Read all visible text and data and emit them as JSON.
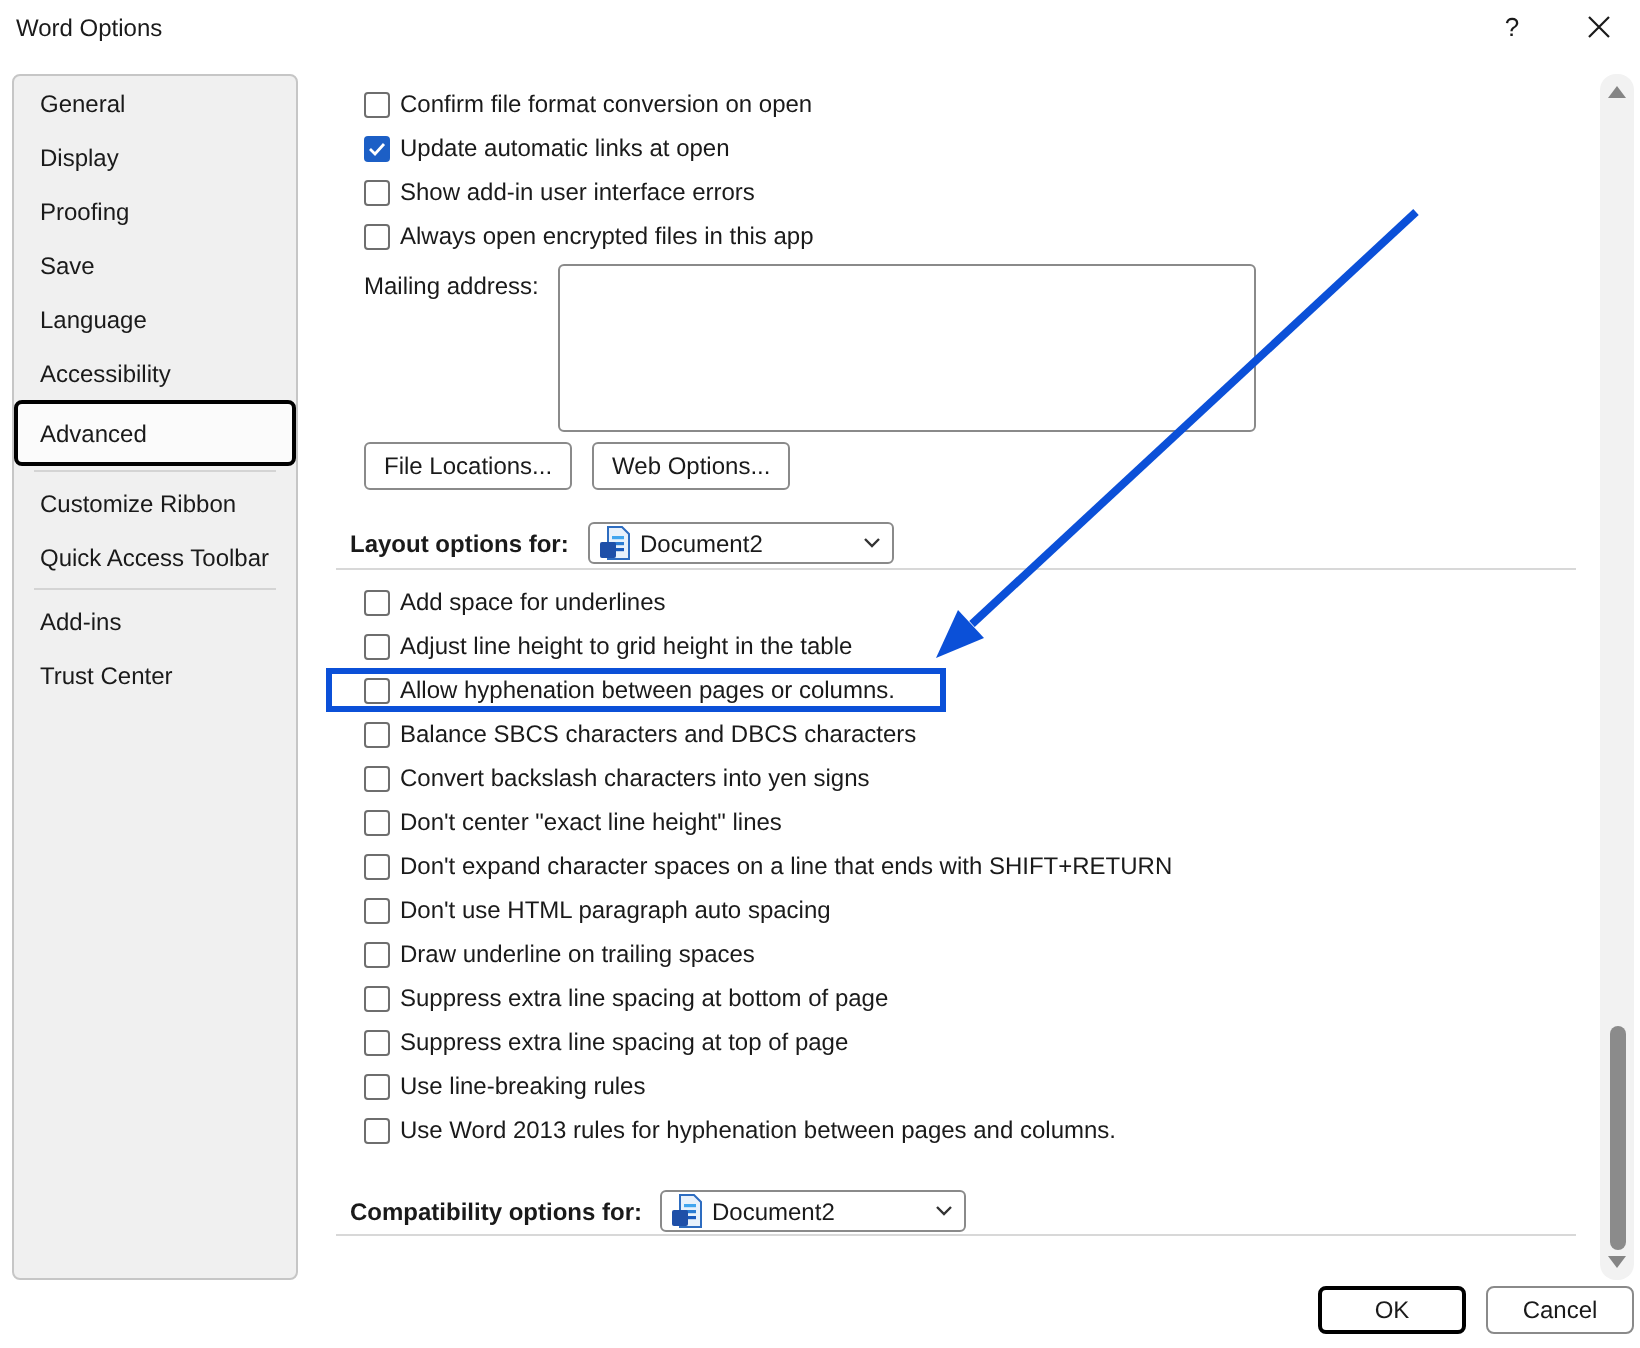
{
  "window": {
    "title": "Word Options",
    "help_label": "?"
  },
  "sidebar": {
    "groups": [
      {
        "items": [
          {
            "label": "General",
            "selected": false
          },
          {
            "label": "Display",
            "selected": false
          },
          {
            "label": "Proofing",
            "selected": false
          },
          {
            "label": "Save",
            "selected": false
          },
          {
            "label": "Language",
            "selected": false
          },
          {
            "label": "Accessibility",
            "selected": false
          },
          {
            "label": "Advanced",
            "selected": true
          }
        ]
      },
      {
        "items": [
          {
            "label": "Customize Ribbon",
            "selected": false
          },
          {
            "label": "Quick Access Toolbar",
            "selected": false
          }
        ]
      },
      {
        "items": [
          {
            "label": "Add-ins",
            "selected": false
          },
          {
            "label": "Trust Center",
            "selected": false
          }
        ]
      }
    ]
  },
  "general_options": [
    {
      "label": "Confirm file format conversion on open",
      "checked": false
    },
    {
      "label": "Update automatic links at open",
      "checked": true
    },
    {
      "label": "Show add-in user interface errors",
      "checked": false
    },
    {
      "label": "Always open encrypted files in this app",
      "checked": false
    }
  ],
  "mailing_address": {
    "label": "Mailing address:"
  },
  "buttons": [
    {
      "label": "File Locations..."
    },
    {
      "label": "Web Options..."
    }
  ],
  "layout_section": {
    "label": "Layout options for:",
    "document": "Document2",
    "options": [
      {
        "label": "Add space for underlines",
        "checked": false,
        "highlighted": false
      },
      {
        "label": "Adjust line height to grid height in the table",
        "checked": false,
        "highlighted": false
      },
      {
        "label": "Allow hyphenation between pages or columns.",
        "checked": false,
        "highlighted": true
      },
      {
        "label": "Balance SBCS characters and DBCS characters",
        "checked": false,
        "highlighted": false
      },
      {
        "label": "Convert backslash characters into yen signs",
        "checked": false,
        "highlighted": false
      },
      {
        "label": "Don't center \"exact line height\" lines",
        "checked": false,
        "highlighted": false
      },
      {
        "label": "Don't expand character spaces on a line that ends with SHIFT+RETURN",
        "checked": false,
        "highlighted": false
      },
      {
        "label": "Don't use HTML paragraph auto spacing",
        "checked": false,
        "highlighted": false
      },
      {
        "label": "Draw underline on trailing spaces",
        "checked": false,
        "highlighted": false
      },
      {
        "label": "Suppress extra line spacing at bottom of page",
        "checked": false,
        "highlighted": false
      },
      {
        "label": "Suppress extra line spacing at top of page",
        "checked": false,
        "highlighted": false
      },
      {
        "label": "Use line-breaking rules",
        "checked": false,
        "highlighted": false
      },
      {
        "label": "Use Word 2013 rules for hyphenation between pages and columns.",
        "checked": false,
        "highlighted": false
      }
    ]
  },
  "compatibility_section": {
    "label": "Compatibility options for:",
    "document": "Document2"
  },
  "footer_buttons": [
    {
      "label": "OK",
      "default": true
    },
    {
      "label": "Cancel",
      "default": false
    }
  ]
}
